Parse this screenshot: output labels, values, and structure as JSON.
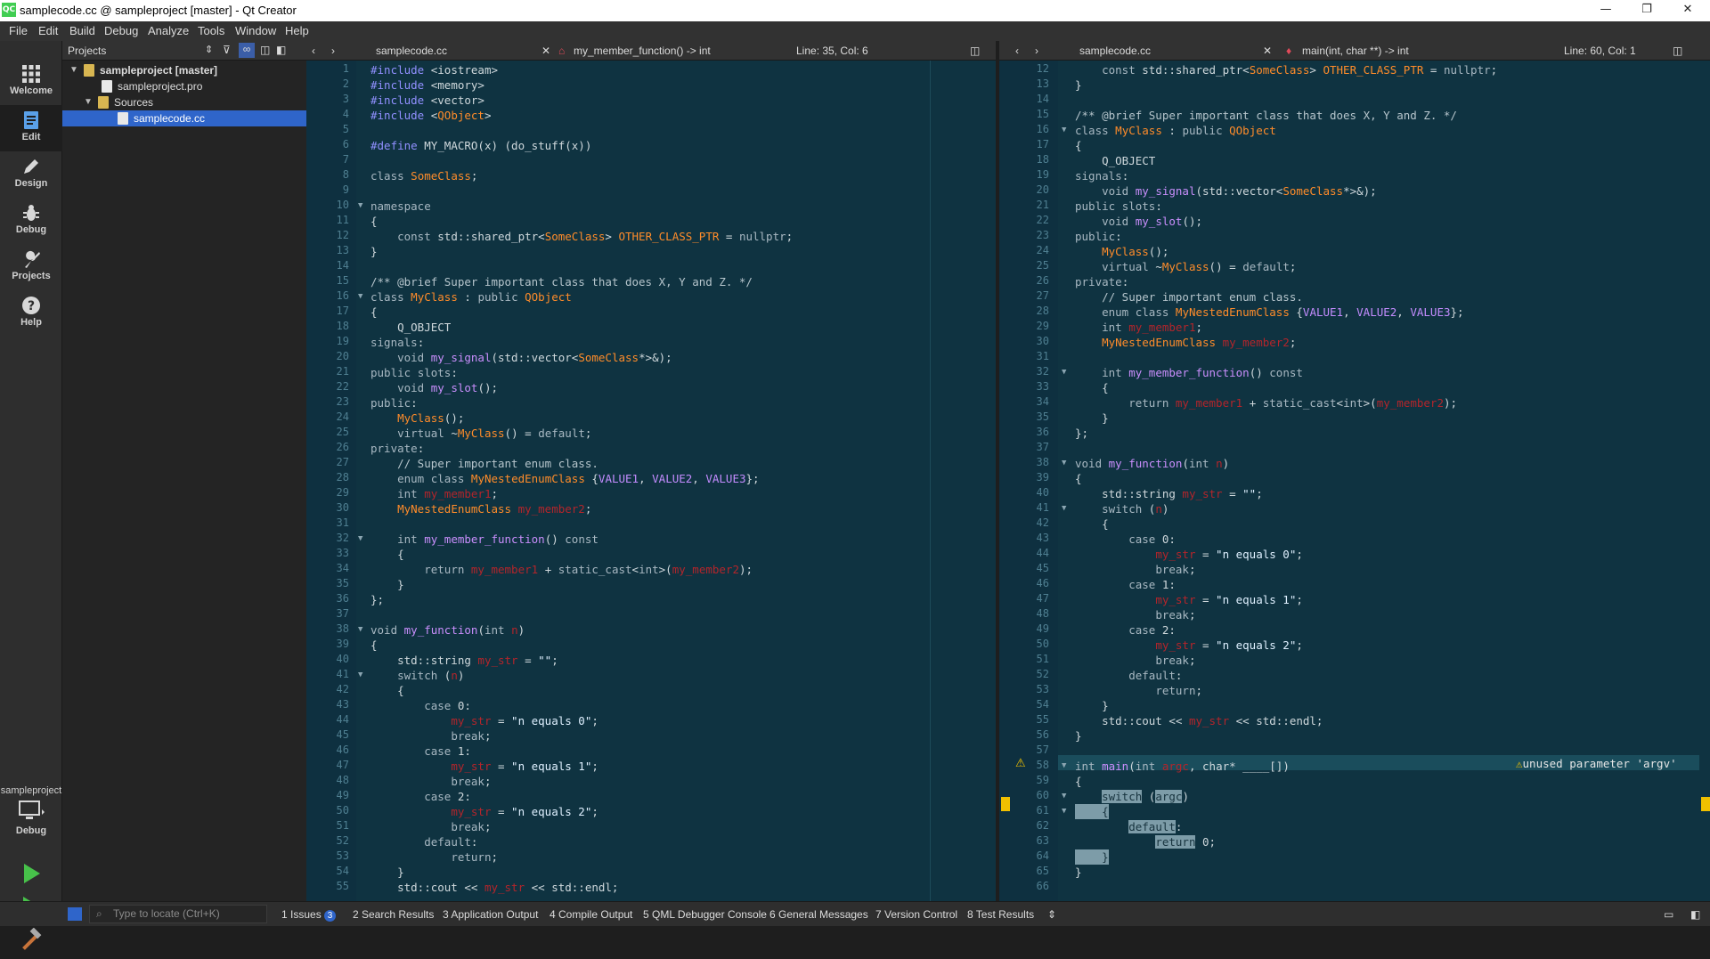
{
  "window": {
    "title": "samplecode.cc @ sampleproject [master] - Qt Creator",
    "app_icon": "QC",
    "minimize": "—",
    "maximize": "❐",
    "close": "✕"
  },
  "menu": [
    "File",
    "Edit",
    "Build",
    "Debug",
    "Analyze",
    "Tools",
    "Window",
    "Help"
  ],
  "modes": [
    "Welcome",
    "Edit",
    "Design",
    "Debug",
    "Projects",
    "Help"
  ],
  "kit": {
    "name": "sampleproject",
    "label": "Debug"
  },
  "projects": {
    "selector": "Projects",
    "tree": [
      {
        "label": "sampleproject [master]"
      },
      {
        "label": "sampleproject.pro"
      },
      {
        "label": "Sources"
      },
      {
        "label": "samplecode.cc"
      }
    ]
  },
  "left_editor": {
    "file": "samplecode.cc",
    "symbol": "my_member_function() -> int",
    "position": "Line: 35, Col: 6"
  },
  "right_editor": {
    "file": "samplecode.cc",
    "symbol": "main(int, char **) -> int",
    "position": "Line: 60, Col: 1",
    "warning": "unused parameter 'argv'"
  },
  "left_code": [
    {
      "n": "1",
      "t": "#include <iostream>"
    },
    {
      "n": "2",
      "t": "#include <memory>"
    },
    {
      "n": "3",
      "t": "#include <vector>"
    },
    {
      "n": "4",
      "t": "#include <QObject>"
    },
    {
      "n": "5",
      "t": ""
    },
    {
      "n": "6",
      "t": "#define MY_MACRO(x) (do_stuff(x))"
    },
    {
      "n": "7",
      "t": ""
    },
    {
      "n": "8",
      "t": "class SomeClass;"
    },
    {
      "n": "9",
      "t": ""
    },
    {
      "n": "10",
      "t": "namespace"
    },
    {
      "n": "11",
      "t": "{"
    },
    {
      "n": "12",
      "t": "    const std::shared_ptr<SomeClass> OTHER_CLASS_PTR = nullptr;"
    },
    {
      "n": "13",
      "t": "}"
    },
    {
      "n": "14",
      "t": ""
    },
    {
      "n": "15",
      "t": "/** @brief Super important class that does X, Y and Z. */"
    },
    {
      "n": "16",
      "t": "class MyClass : public QObject"
    },
    {
      "n": "17",
      "t": "{"
    },
    {
      "n": "18",
      "t": "    Q_OBJECT"
    },
    {
      "n": "19",
      "t": "signals:"
    },
    {
      "n": "20",
      "t": "    void my_signal(std::vector<SomeClass*>&);"
    },
    {
      "n": "21",
      "t": "public slots:"
    },
    {
      "n": "22",
      "t": "    void my_slot();"
    },
    {
      "n": "23",
      "t": "public:"
    },
    {
      "n": "24",
      "t": "    MyClass();"
    },
    {
      "n": "25",
      "t": "    virtual ~MyClass() = default;"
    },
    {
      "n": "26",
      "t": "private:"
    },
    {
      "n": "27",
      "t": "    // Super important enum class."
    },
    {
      "n": "28",
      "t": "    enum class MyNestedEnumClass {VALUE1, VALUE2, VALUE3};"
    },
    {
      "n": "29",
      "t": "    int my_member1;"
    },
    {
      "n": "30",
      "t": "    MyNestedEnumClass my_member2;"
    },
    {
      "n": "31",
      "t": ""
    },
    {
      "n": "32",
      "t": "    int my_member_function() const"
    },
    {
      "n": "33",
      "t": "    {"
    },
    {
      "n": "34",
      "t": "        return my_member1 + static_cast<int>(my_member2);"
    },
    {
      "n": "35",
      "t": "    }"
    },
    {
      "n": "36",
      "t": "};"
    },
    {
      "n": "37",
      "t": ""
    },
    {
      "n": "38",
      "t": "void my_function(int n)"
    },
    {
      "n": "39",
      "t": "{"
    },
    {
      "n": "40",
      "t": "    std::string my_str = \"\";"
    },
    {
      "n": "41",
      "t": "    switch (n)"
    },
    {
      "n": "42",
      "t": "    {"
    },
    {
      "n": "43",
      "t": "        case 0:"
    },
    {
      "n": "44",
      "t": "            my_str = \"n equals 0\";"
    },
    {
      "n": "45",
      "t": "            break;"
    },
    {
      "n": "46",
      "t": "        case 1:"
    },
    {
      "n": "47",
      "t": "            my_str = \"n equals 1\";"
    },
    {
      "n": "48",
      "t": "            break;"
    },
    {
      "n": "49",
      "t": "        case 2:"
    },
    {
      "n": "50",
      "t": "            my_str = \"n equals 2\";"
    },
    {
      "n": "51",
      "t": "            break;"
    },
    {
      "n": "52",
      "t": "        default:"
    },
    {
      "n": "53",
      "t": "            return;"
    },
    {
      "n": "54",
      "t": "    }"
    },
    {
      "n": "55",
      "t": "    std::cout << my_str << std::endl;"
    }
  ],
  "right_code": [
    {
      "n": "12",
      "t": "    const std::shared_ptr<SomeClass> OTHER_CLASS_PTR = nullptr;"
    },
    {
      "n": "13",
      "t": "}"
    },
    {
      "n": "14",
      "t": ""
    },
    {
      "n": "15",
      "t": "/** @brief Super important class that does X, Y and Z. */"
    },
    {
      "n": "16",
      "t": "class MyClass : public QObject"
    },
    {
      "n": "17",
      "t": "{"
    },
    {
      "n": "18",
      "t": "    Q_OBJECT"
    },
    {
      "n": "19",
      "t": "signals:"
    },
    {
      "n": "20",
      "t": "    void my_signal(std::vector<SomeClass*>&);"
    },
    {
      "n": "21",
      "t": "public slots:"
    },
    {
      "n": "22",
      "t": "    void my_slot();"
    },
    {
      "n": "23",
      "t": "public:"
    },
    {
      "n": "24",
      "t": "    MyClass();"
    },
    {
      "n": "25",
      "t": "    virtual ~MyClass() = default;"
    },
    {
      "n": "26",
      "t": "private:"
    },
    {
      "n": "27",
      "t": "    // Super important enum class."
    },
    {
      "n": "28",
      "t": "    enum class MyNestedEnumClass {VALUE1, VALUE2, VALUE3};"
    },
    {
      "n": "29",
      "t": "    int my_member1;"
    },
    {
      "n": "30",
      "t": "    MyNestedEnumClass my_member2;"
    },
    {
      "n": "31",
      "t": ""
    },
    {
      "n": "32",
      "t": "    int my_member_function() const"
    },
    {
      "n": "33",
      "t": "    {"
    },
    {
      "n": "34",
      "t": "        return my_member1 + static_cast<int>(my_member2);"
    },
    {
      "n": "35",
      "t": "    }"
    },
    {
      "n": "36",
      "t": "};"
    },
    {
      "n": "37",
      "t": ""
    },
    {
      "n": "38",
      "t": "void my_function(int n)"
    },
    {
      "n": "39",
      "t": "{"
    },
    {
      "n": "40",
      "t": "    std::string my_str = \"\";"
    },
    {
      "n": "41",
      "t": "    switch (n)"
    },
    {
      "n": "42",
      "t": "    {"
    },
    {
      "n": "43",
      "t": "        case 0:"
    },
    {
      "n": "44",
      "t": "            my_str = \"n equals 0\";"
    },
    {
      "n": "45",
      "t": "            break;"
    },
    {
      "n": "46",
      "t": "        case 1:"
    },
    {
      "n": "47",
      "t": "            my_str = \"n equals 1\";"
    },
    {
      "n": "48",
      "t": "            break;"
    },
    {
      "n": "49",
      "t": "        case 2:"
    },
    {
      "n": "50",
      "t": "            my_str = \"n equals 2\";"
    },
    {
      "n": "51",
      "t": "            break;"
    },
    {
      "n": "52",
      "t": "        default:"
    },
    {
      "n": "53",
      "t": "            return;"
    },
    {
      "n": "54",
      "t": "    }"
    },
    {
      "n": "55",
      "t": "    std::cout << my_str << std::endl;"
    },
    {
      "n": "56",
      "t": "}"
    },
    {
      "n": "57",
      "t": ""
    },
    {
      "n": "58",
      "t": "int main(int argc, char* ____[])"
    },
    {
      "n": "59",
      "t": "{"
    },
    {
      "n": "60",
      "t": "    switch (argc)"
    },
    {
      "n": "61",
      "t": "    {"
    },
    {
      "n": "62",
      "t": "        default:"
    },
    {
      "n": "63",
      "t": "            return 0;"
    },
    {
      "n": "64",
      "t": "    }"
    },
    {
      "n": "65",
      "t": "}"
    },
    {
      "n": "66",
      "t": ""
    }
  ],
  "statusbar": {
    "locate_placeholder": "Type to locate (Ctrl+K)",
    "tabs": [
      {
        "label": "1  Issues",
        "badge": "3"
      },
      {
        "label": "2  Search Results"
      },
      {
        "label": "3  Application Output"
      },
      {
        "label": "4  Compile Output"
      },
      {
        "label": "5  QML Debugger Console"
      },
      {
        "label": "6  General Messages"
      },
      {
        "label": "7  Version Control"
      },
      {
        "label": "8  Test Results"
      }
    ]
  },
  "colors": {
    "accent": "#2f65ca",
    "editor_bg": "#0f3341",
    "warning": "#f0c000"
  }
}
